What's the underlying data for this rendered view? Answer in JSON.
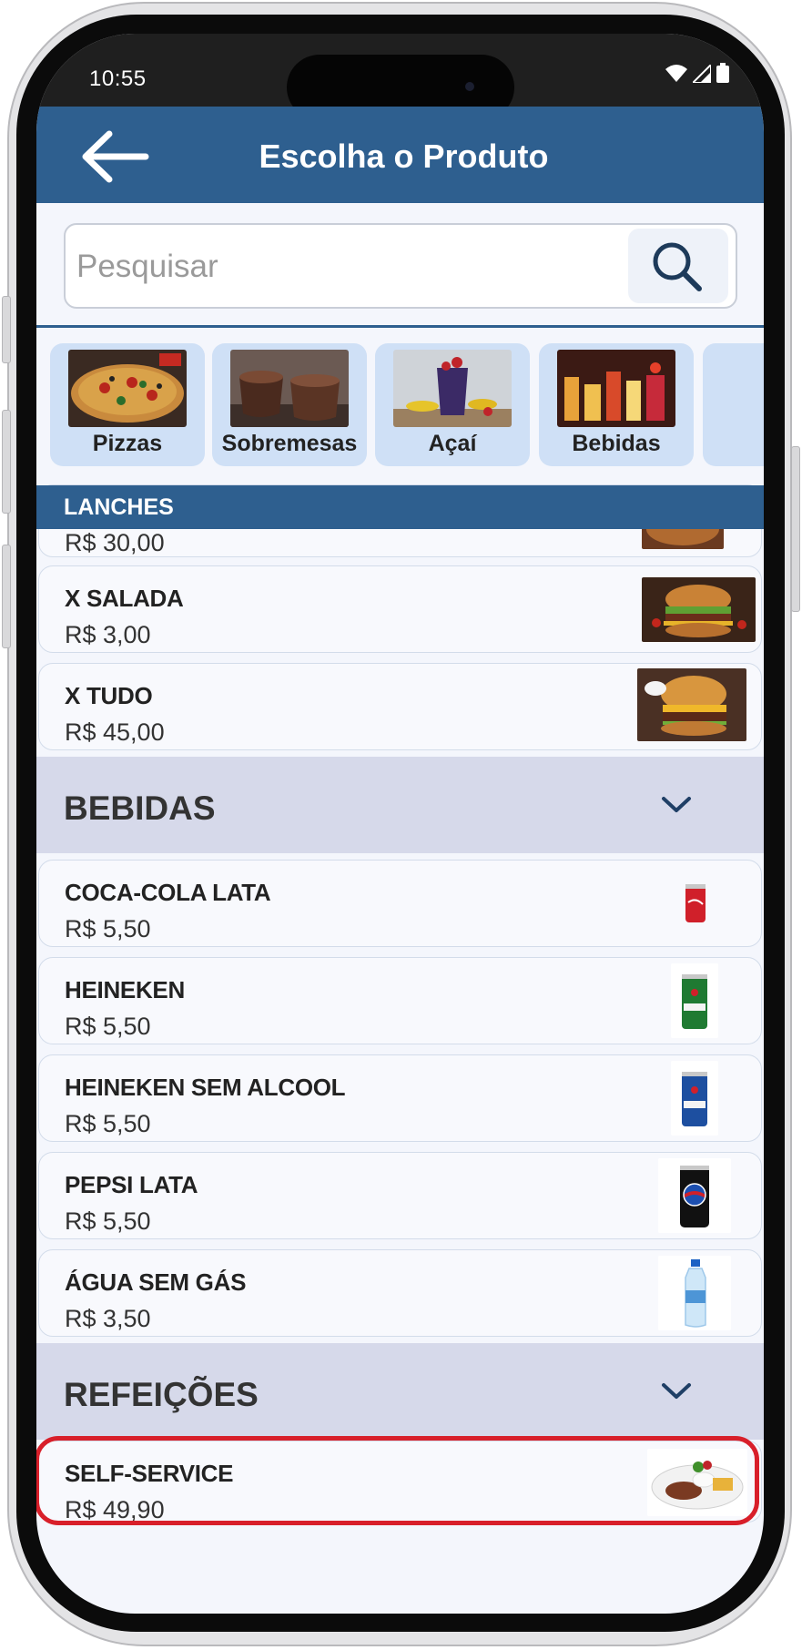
{
  "status_bar": {
    "time": "10:55"
  },
  "header": {
    "title": "Escolha o Produto"
  },
  "search": {
    "placeholder": "Pesquisar"
  },
  "categories": [
    {
      "label": "Pizzas"
    },
    {
      "label": "Sobremesas"
    },
    {
      "label": "Açaí"
    },
    {
      "label": "Bebidas"
    }
  ],
  "sticky_section": {
    "title": "LANCHES"
  },
  "lanches": {
    "partial_price": "R$ 30,00",
    "items": [
      {
        "name": "X SALADA",
        "price": "R$ 3,00"
      },
      {
        "name": "X TUDO",
        "price": "R$ 45,00"
      }
    ]
  },
  "bebidas": {
    "title": "BEBIDAS",
    "items": [
      {
        "name": "COCA-COLA LATA",
        "price": "R$ 5,50"
      },
      {
        "name": "HEINEKEN",
        "price": "R$ 5,50"
      },
      {
        "name": "HEINEKEN SEM ALCOOL",
        "price": "R$ 5,50"
      },
      {
        "name": "PEPSI LATA",
        "price": "R$ 5,50"
      },
      {
        "name": "ÁGUA SEM GÁS",
        "price": "R$ 3,50"
      }
    ]
  },
  "refeicoes": {
    "title": "REFEIÇÕES",
    "items": [
      {
        "name": "SELF-SERVICE",
        "price": "R$ 49,90"
      }
    ]
  },
  "colors": {
    "header_blue": "#2e5f8f",
    "section_gray": "#d6d9ea",
    "category_card": "#cfe0f6",
    "highlight_red": "#d81f2a"
  }
}
